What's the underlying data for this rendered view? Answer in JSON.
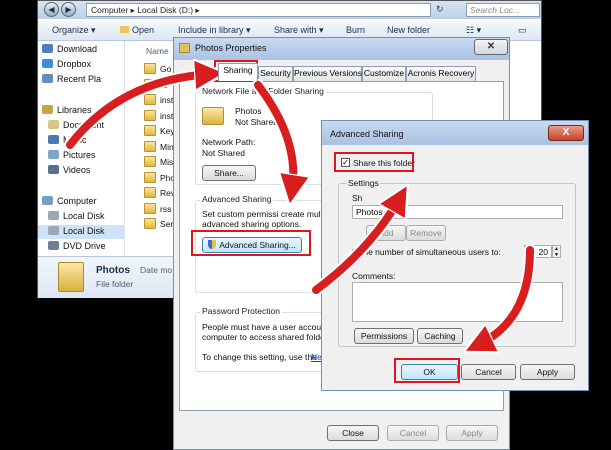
{
  "explorer": {
    "address": "Computer ▸ Local Disk (D:) ▸",
    "search_placeholder": "Search Loc...",
    "toolbar": {
      "organize": "Organize ▾",
      "open": "Open",
      "include": "Include in library ▾",
      "share": "Share with ▾",
      "burn": "Burn",
      "new_folder": "New folder"
    },
    "nav": {
      "downloads": "Download",
      "dropbox": "Dropbox",
      "recent": "Recent Pla",
      "libraries": "Libraries",
      "documents": "Document",
      "music": "Music",
      "pictures": "Pictures",
      "videos": "Videos",
      "computer": "Computer",
      "local1": "Local Disk",
      "local2": "Local Disk",
      "dvd": "DVD Drive"
    },
    "column_header": "Name",
    "files": [
      "Go",
      "ID",
      "inst",
      "inst",
      "Key",
      "Min",
      "Mis",
      "Pho",
      "Rev",
      "rss",
      "Ser"
    ],
    "details": {
      "name": "Photos",
      "type": "File folder",
      "date_label": "Date mo"
    }
  },
  "props": {
    "title": "Photos Properties",
    "tabs": [
      "Sharing",
      "Security",
      "Previous Versions",
      "Customize",
      "Acronis Recovery"
    ],
    "net_group_title": "Network File and Folder Sharing",
    "folder_name": "Photos",
    "folder_status": "Not Shared",
    "net_path_label": "Network Path:",
    "net_path_value": "Not Shared",
    "share_button": "Share...",
    "adv_group_title": "Advanced Sharing",
    "adv_desc_1": "Set custom permissi   create mult",
    "adv_desc_2": "advanced sharing options.",
    "adv_button": "Advanced Sharing...",
    "pwd_group_title": "Password Protection",
    "pwd_desc_1": "People must have a user account a",
    "pwd_desc_2": "computer to access shared folders.",
    "pwd_desc_3": "To change this setting, use the",
    "pwd_link": "Netw",
    "close": "Close",
    "cancel": "Cancel",
    "apply": "Apply"
  },
  "adv": {
    "title": "Advanced Sharing",
    "close_x": "X",
    "share_checkbox": "Share this folder",
    "settings_label": "Settings",
    "share_name_label": "Sh",
    "share_name_value": "Photos",
    "add": "Add",
    "remove": "Remove",
    "limit_label": "Li        the number of simultaneous users to:",
    "limit_value": "20",
    "comments_label": "Comments:",
    "permissions": "Permissions",
    "caching": "Caching",
    "ok": "OK",
    "cancel": "Cancel",
    "apply": "Apply"
  },
  "colors": {
    "highlight": "#e0151b",
    "arrow": "#d81e1e",
    "titlebar": "#a9c2e3"
  }
}
